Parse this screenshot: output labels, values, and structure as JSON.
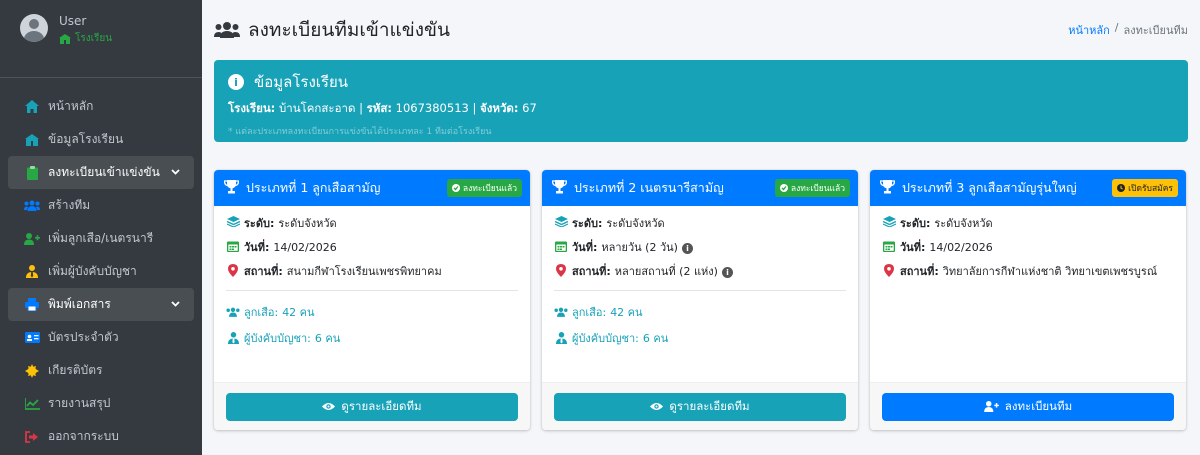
{
  "user": {
    "name": "User",
    "role": "โรงเรียน"
  },
  "sidebar": {
    "items": [
      {
        "label": "หน้าหลัก",
        "icon": "home-icon",
        "color": "#17a2b8",
        "active": false
      },
      {
        "label": "ข้อมูลโรงเรียน",
        "icon": "school-icon",
        "color": "#17a2b8",
        "active": false
      },
      {
        "label": "ลงทะเบียนเข้าแข่งขัน",
        "icon": "clipboard-icon",
        "color": "#28a745",
        "active": true,
        "chevron": true
      },
      {
        "label": "สร้างทีม",
        "icon": "users-icon",
        "color": "#007bff",
        "active": false
      },
      {
        "label": "เพิ่มลูกเสือ/เนตรนารี",
        "icon": "user-plus-icon",
        "color": "#28a745",
        "active": false
      },
      {
        "label": "เพิ่มผู้บังคับบัญชา",
        "icon": "user-tie-icon",
        "color": "#ffc107",
        "active": false
      },
      {
        "label": "พิมพ์เอกสาร",
        "icon": "print-icon",
        "color": "#007bff",
        "active": true,
        "chevron": true
      },
      {
        "label": "บัตรประจำตัว",
        "icon": "id-card-icon",
        "color": "#007bff",
        "active": false
      },
      {
        "label": "เกียรติบัตร",
        "icon": "certificate-icon",
        "color": "#ffc107",
        "active": false
      },
      {
        "label": "รายงานสรุป",
        "icon": "chart-icon",
        "color": "#28a745",
        "active": false
      },
      {
        "label": "ออกจากระบบ",
        "icon": "logout-icon",
        "color": "#dc3545",
        "active": false
      }
    ]
  },
  "header": {
    "title": "ลงทะเบียนทีมเข้าแข่งขัน"
  },
  "breadcrumb": {
    "home": "หน้าหลัก",
    "separator": "/",
    "current": "ลงทะเบียนทีม"
  },
  "school_info": {
    "title": "ข้อมูลโรงเรียน",
    "school_label": "โรงเรียน:",
    "school_name": "บ้านโคกสะอาด",
    "code_label": "รหัส:",
    "code": "1067380513",
    "province_label": "จังหวัด:",
    "province": "67",
    "note": "* แต่ละประเภทลงทะเบียนการแข่งขันได้ประเภทละ 1 ทีมต่อโรงเรียน"
  },
  "cards": [
    {
      "title": "ประเภทที่ 1 ลูกเสือสามัญ",
      "badge": "ลงทะเบียนแล้ว",
      "badge_style": "green",
      "level_label": "ระดับ:",
      "level": "ระดับจังหวัด",
      "date_label": "วันที่:",
      "date": "14/02/2026",
      "date_info": false,
      "venue_label": "สถานที่:",
      "venue": "สนามกีฬาโรงเรียนเพชรพิทยาคม",
      "venue_info": false,
      "scouts_label": "ลูกเสือ:",
      "scouts": "42 คน",
      "leaders_label": "ผู้บังคับบัญชา:",
      "leaders": "6 คน",
      "button": "ดูรายละเอียดทีม",
      "button_style": "info"
    },
    {
      "title": "ประเภทที่ 2 เนตรนารีสามัญ",
      "badge": "ลงทะเบียนแล้ว",
      "badge_style": "green",
      "level_label": "ระดับ:",
      "level": "ระดับจังหวัด",
      "date_label": "วันที่:",
      "date": "หลายวัน (2 วัน)",
      "date_info": true,
      "venue_label": "สถานที่:",
      "venue": "หลายสถานที่ (2 แห่ง)",
      "venue_info": true,
      "scouts_label": "ลูกเสือ:",
      "scouts": "42 คน",
      "leaders_label": "ผู้บังคับบัญชา:",
      "leaders": "6 คน",
      "button": "ดูรายละเอียดทีม",
      "button_style": "info"
    },
    {
      "title": "ประเภทที่ 3 ลูกเสือสามัญรุ่นใหญ่",
      "badge": "เปิดรับสมัคร",
      "badge_style": "yellow",
      "level_label": "ระดับ:",
      "level": "ระดับจังหวัด",
      "date_label": "วันที่:",
      "date": "14/02/2026",
      "date_info": false,
      "venue_label": "สถานที่:",
      "venue": "วิทยาลัยการกีฬาแห่งชาติ วิทยาเขตเพชรบูรณ์",
      "venue_info": false,
      "button": "ลงทะเบียนทีม",
      "button_style": "primary"
    }
  ],
  "colors": {
    "sidebar_bg": "#343a40",
    "primary": "#007bff",
    "info": "#17a2b8",
    "success": "#28a745",
    "warning": "#ffc107"
  }
}
